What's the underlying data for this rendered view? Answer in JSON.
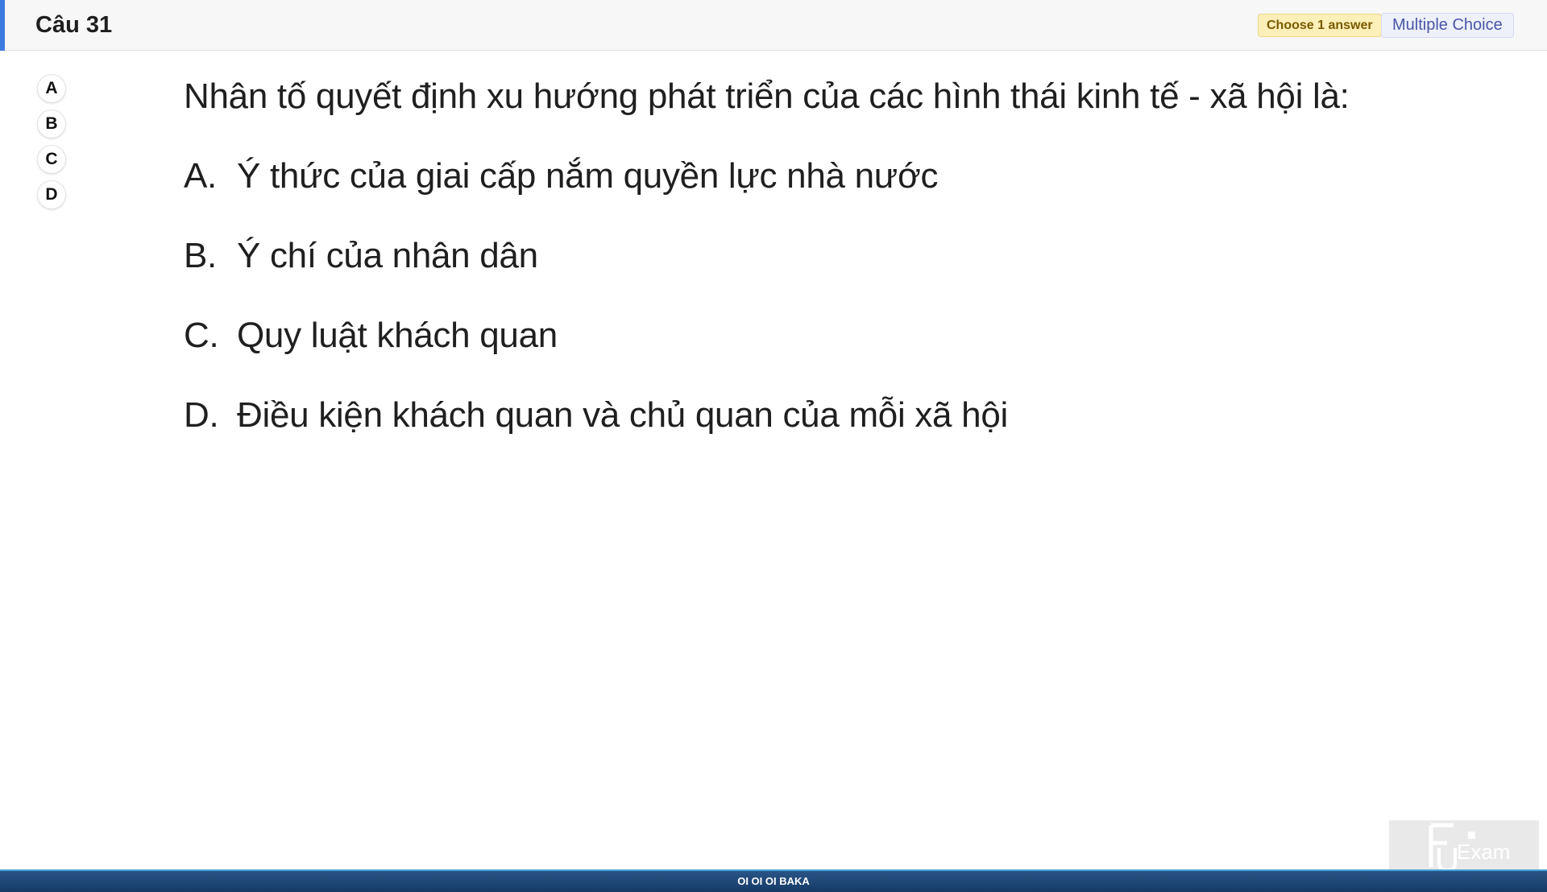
{
  "header": {
    "question_number": "Câu 31",
    "choose_badge": "Choose 1 answer",
    "question_type": "Multiple Choice",
    "accent_color": "#3d7be0"
  },
  "answer_selector": {
    "options": [
      "A",
      "B",
      "C",
      "D"
    ]
  },
  "question": {
    "stem": "Nhân tố quyết định xu hướng phát triển của các hình thái kinh tế - xã hội là:",
    "choices": [
      {
        "letter": "A.",
        "text": "Ý thức của giai cấp nắm quyền lực nhà nước"
      },
      {
        "letter": "B.",
        "text": "Ý chí của nhân dân"
      },
      {
        "letter": "C.",
        "text": "Quy luật khách quan"
      },
      {
        "letter": "D.",
        "text": "Điều kiện khách quan và chủ quan của mỗi xã hội"
      }
    ]
  },
  "logo": {
    "text": "Exam"
  },
  "footer": {
    "text": "OI OI OI BAKA"
  }
}
